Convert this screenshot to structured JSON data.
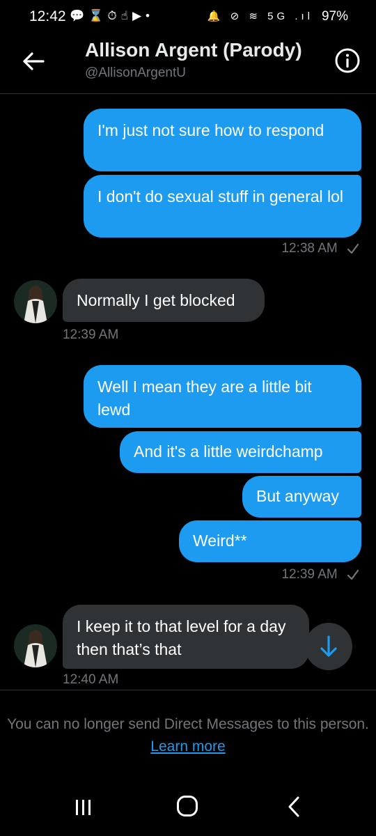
{
  "status_bar": {
    "time": "12:42",
    "left_icons": "💬⌛⏱☝▶•",
    "right_icons": "🔔 ⊘ ≋ 5G .ıl",
    "battery": "97%"
  },
  "header": {
    "name": "Allison Argent (Parody)",
    "handle": "@AllisonArgentU",
    "back_icon": "arrow-left-icon",
    "info_icon": "info-icon"
  },
  "colors": {
    "background": "#000000",
    "outgoing_bubble": "#1d9bf0",
    "incoming_bubble": "#2f3336",
    "secondary_text": "#71767b",
    "link": "#1d9bf0"
  },
  "messages": [
    {
      "direction": "out",
      "text": "I'm just not sure how to respond"
    },
    {
      "direction": "out",
      "text": "I don't do sexual stuff in general lol"
    },
    {
      "direction": "out_timestamp",
      "text": "12:38 AM"
    },
    {
      "direction": "in",
      "text": "Normally I get blocked"
    },
    {
      "direction": "in_timestamp",
      "text": "12:39 AM"
    },
    {
      "direction": "out",
      "text": "Well I mean they are a little bit lewd"
    },
    {
      "direction": "out",
      "text": "And it's a little weirdchamp"
    },
    {
      "direction": "out",
      "text": "But anyway"
    },
    {
      "direction": "out",
      "text": "Weird**"
    },
    {
      "direction": "out_timestamp",
      "text": "12:39 AM"
    },
    {
      "direction": "in",
      "text": "I keep it to that level for a day then that’s that"
    },
    {
      "direction": "in_timestamp",
      "text": "12:40 AM"
    }
  ],
  "footer": {
    "notice": "You can no longer send Direct Messages to this person.",
    "link": "Learn more"
  }
}
